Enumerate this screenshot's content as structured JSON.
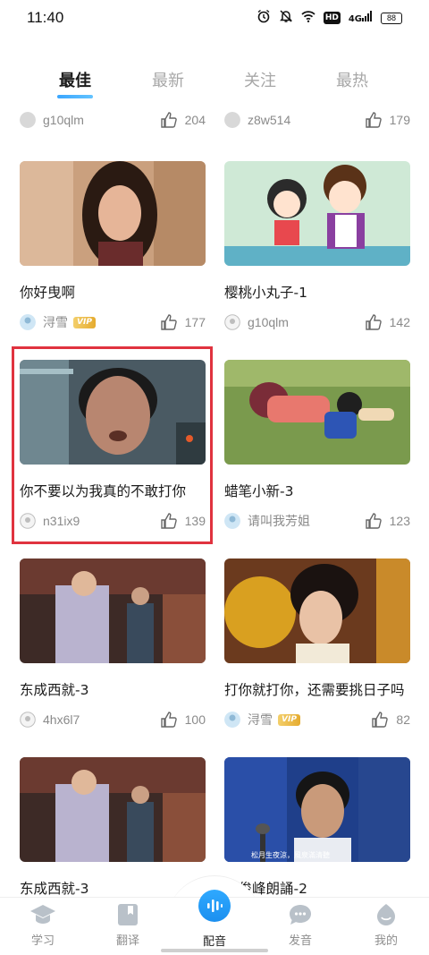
{
  "status_bar": {
    "time": "11:40",
    "network": "4G",
    "hd": "HD",
    "battery": "88"
  },
  "tabs": [
    {
      "label": "最佳",
      "active": true
    },
    {
      "label": "最新",
      "active": false
    },
    {
      "label": "关注",
      "active": false
    },
    {
      "label": "最热",
      "active": false
    }
  ],
  "partial_row": [
    {
      "user": "g10qlm",
      "likes": "204"
    },
    {
      "user": "z8w514",
      "likes": "179"
    }
  ],
  "cards": [
    {
      "title": "你好曳啊",
      "user": "浔雪",
      "vip": "VIP",
      "likes": "177"
    },
    {
      "title": "樱桃小丸子-1",
      "user": "g10qlm",
      "vip": "",
      "likes": "142"
    },
    {
      "title": "你不要以为我真的不敢打你",
      "user": "n31ix9",
      "vip": "",
      "likes": "139",
      "highlighted": true
    },
    {
      "title": "蜡笔小新-3",
      "user": "请叫我芳姐",
      "vip": "",
      "likes": "123"
    },
    {
      "title": "东成西就-3",
      "user": "4hx6l7",
      "vip": "",
      "likes": "100"
    },
    {
      "title": "打你就打你，还需要挑日子吗",
      "user": "浔雪",
      "vip": "VIP",
      "likes": "82"
    },
    {
      "title": "东成西就-3",
      "user": "",
      "vip": "",
      "likes": ""
    },
    {
      "title": "林俊峰朗誦-2",
      "user": "",
      "vip": "",
      "likes": ""
    }
  ],
  "thumb_caption": "松月生夜涼，風泉滿清聽",
  "bottom_nav": [
    {
      "label": "学习",
      "icon": "graduation-cap-icon"
    },
    {
      "label": "翻译",
      "icon": "bookmark-icon"
    },
    {
      "label": "配音",
      "icon": "sound-wave-icon",
      "active": true
    },
    {
      "label": "发音",
      "icon": "chat-bubble-icon"
    },
    {
      "label": "我的",
      "icon": "profile-icon"
    }
  ],
  "colors": {
    "accent": "#2196f3",
    "highlight": "#e0333f",
    "vip": "#e5ab2f"
  }
}
